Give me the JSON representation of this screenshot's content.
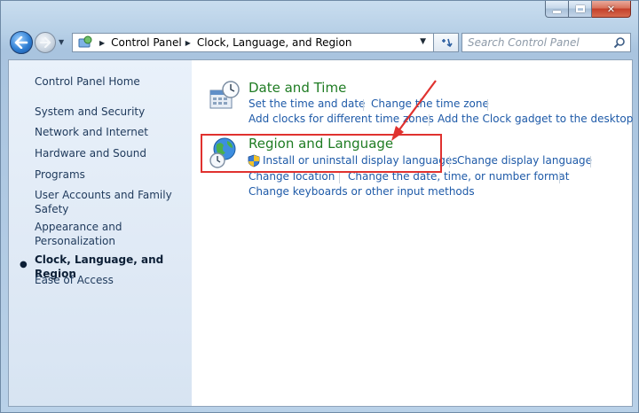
{
  "window": {
    "caption_buttons": [
      "minimize",
      "maximize",
      "close"
    ]
  },
  "nav": {
    "back_icon": "back-arrow-icon",
    "forward_icon": "forward-arrow-icon",
    "address_segments": [
      "Control Panel",
      "Clock, Language, and Region"
    ],
    "search_placeholder": "Search Control Panel"
  },
  "sidebar": {
    "home": "Control Panel Home",
    "items": [
      {
        "label": "System and Security"
      },
      {
        "label": "Network and Internet"
      },
      {
        "label": "Hardware and Sound"
      },
      {
        "label": "Programs"
      },
      {
        "label": "User Accounts and Family Safety"
      },
      {
        "label": "Appearance and Personalization"
      },
      {
        "label": "Clock, Language, and Region",
        "current": true
      },
      {
        "label": "Ease of Access"
      }
    ]
  },
  "categories": [
    {
      "title": "Date and Time",
      "icon": "clock-calendar-icon",
      "links": [
        "Set the time and date",
        "Change the time zone",
        "Add clocks for different time zones",
        "Add the Clock gadget to the desktop"
      ]
    },
    {
      "title": "Region and Language",
      "icon": "globe-clock-icon",
      "links": [
        "Install or uninstall display languages",
        "Change display language",
        "Change location",
        "Change the date, time, or number format",
        "Change keyboards or other input methods"
      ]
    }
  ],
  "annotation": {
    "highlight_color": "#e0322f"
  }
}
